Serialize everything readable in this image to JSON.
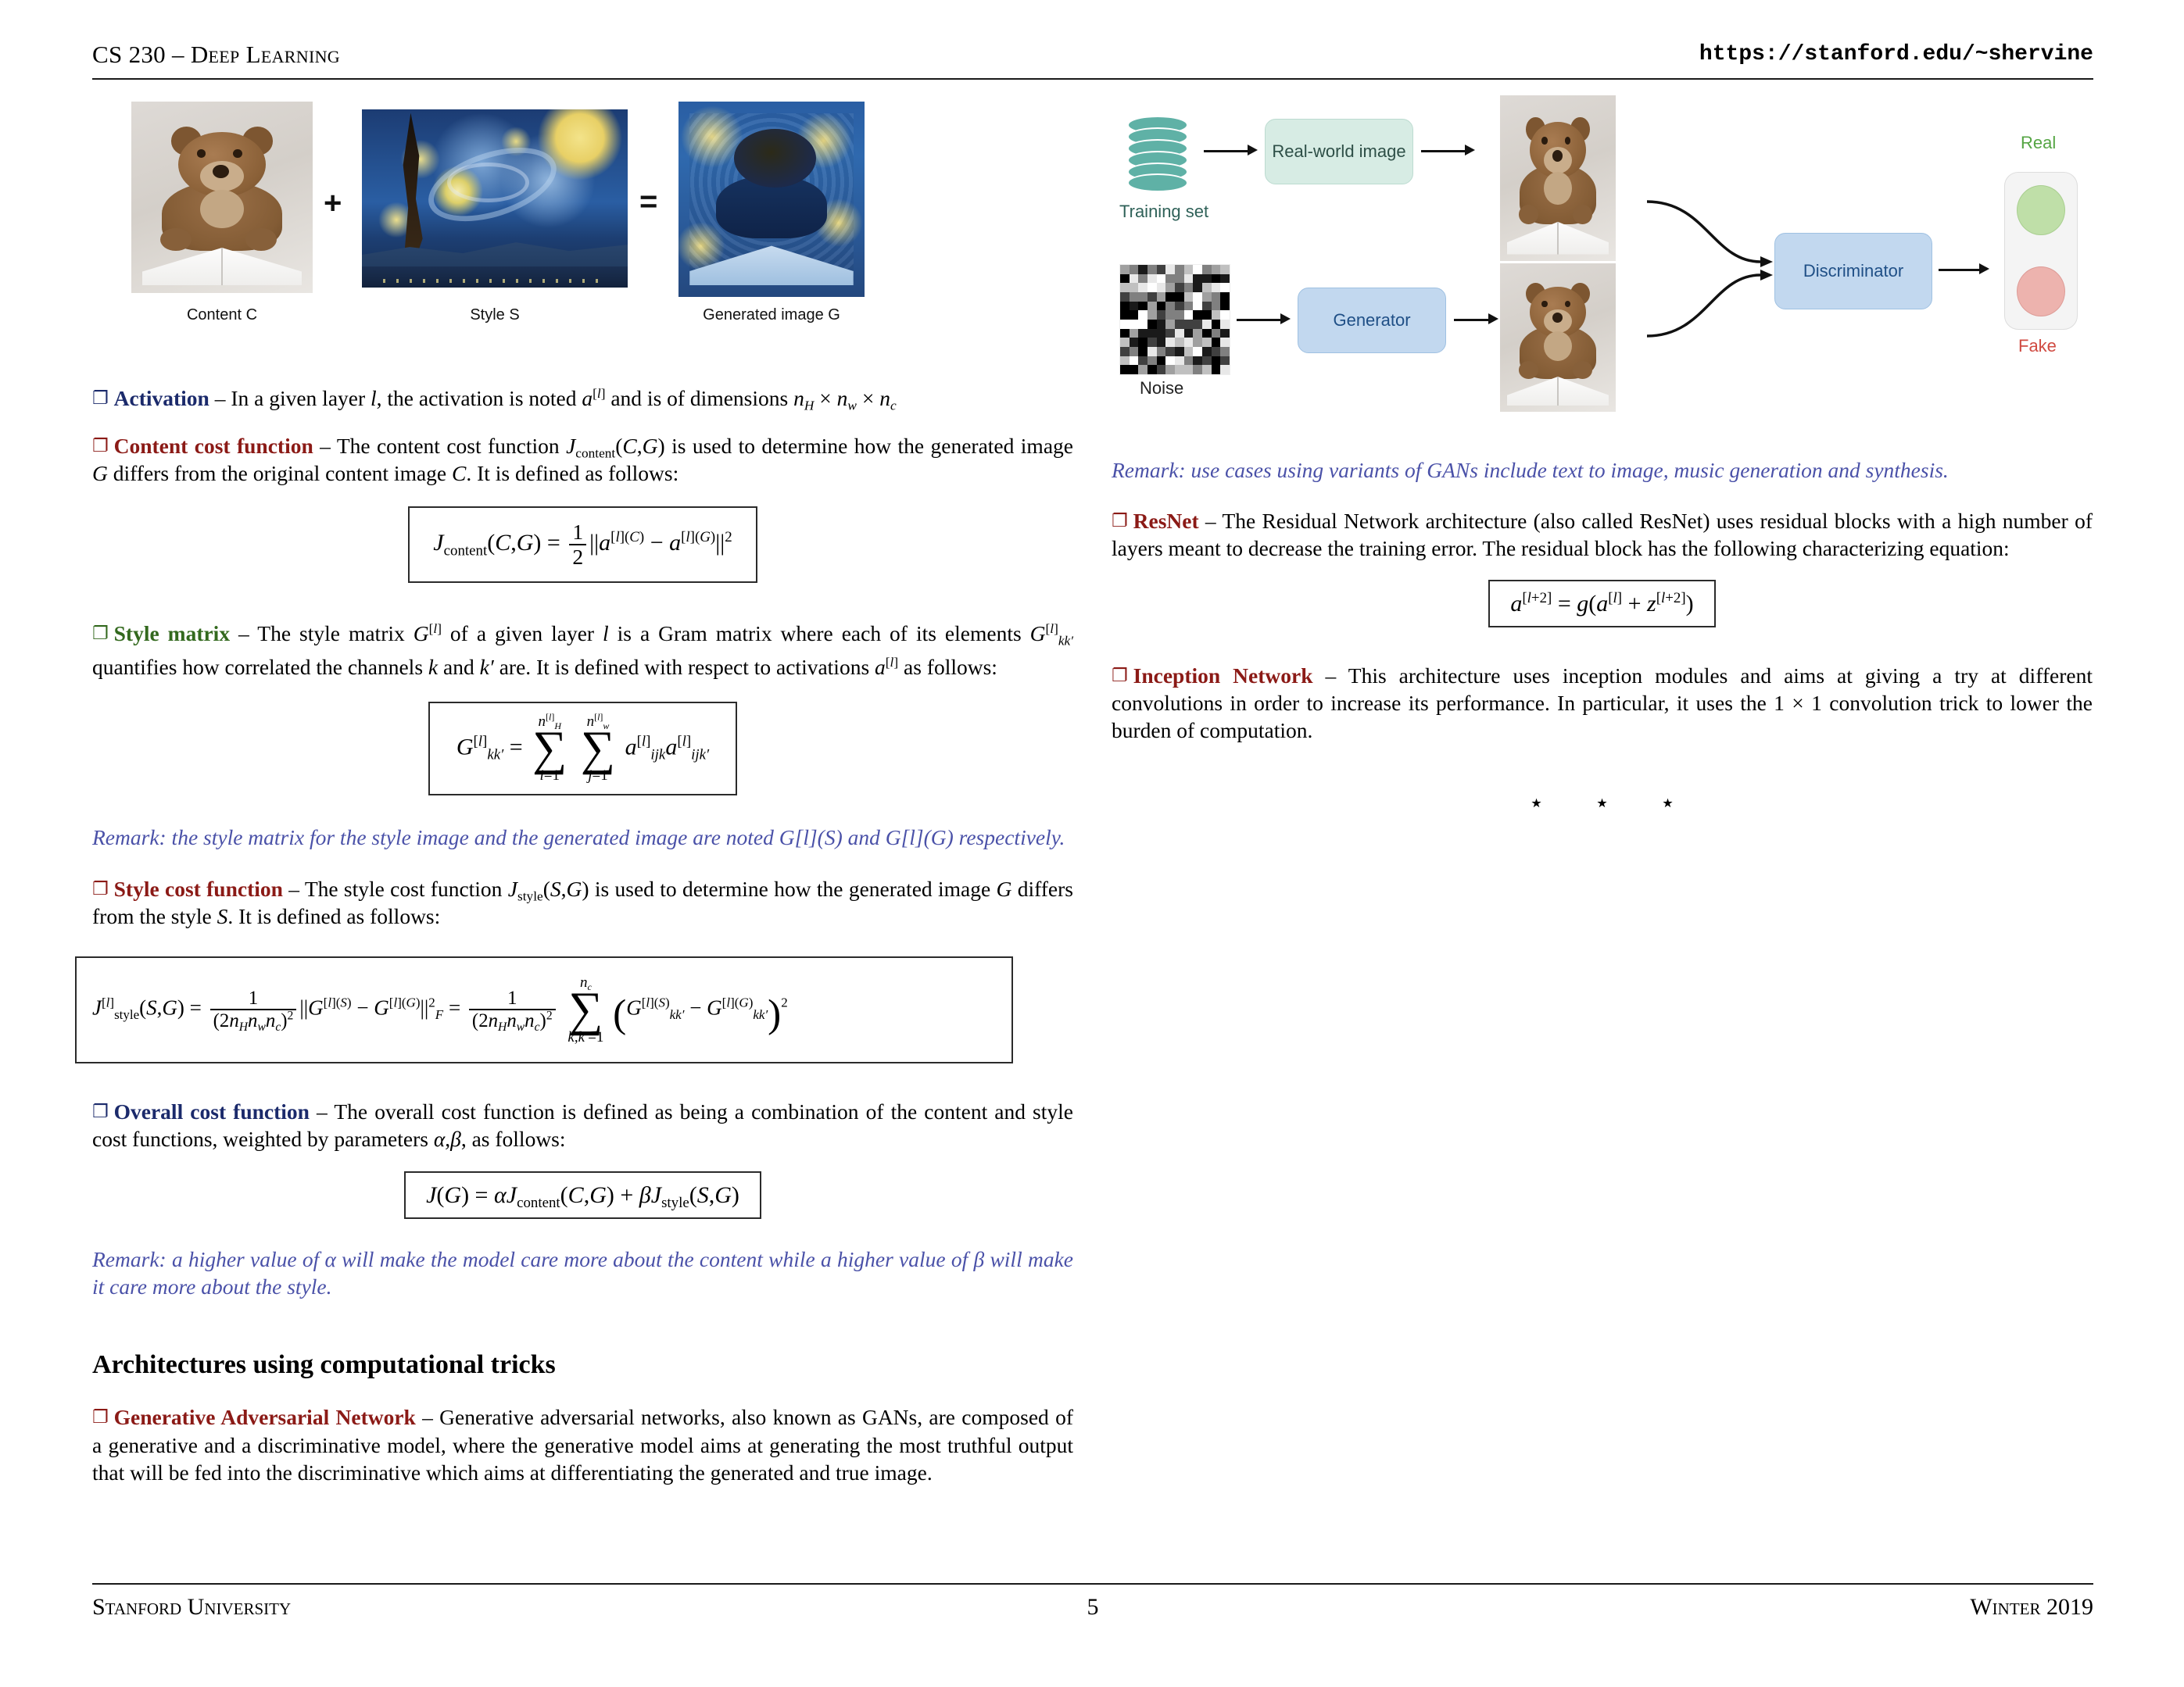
{
  "header": {
    "course": "CS 230 – Deep Learning",
    "url": "https://stanford.edu/~shervine"
  },
  "footer": {
    "left": "Stanford University",
    "page": "5",
    "right": "Winter 2019"
  },
  "style_transfer_figure": {
    "content_caption": "Content C",
    "style_caption": "Style S",
    "generated_caption": "Generated image G",
    "plus_operator": "+",
    "equals_operator": "="
  },
  "left_column": {
    "activation": {
      "bullet": "❐",
      "heading": "Activation",
      "dash": " – ",
      "text_1": "In a given layer ",
      "text_2": ", the activation is noted ",
      "text_3": " and is of dimensions ",
      "l": "l",
      "a": "a",
      "sup_l": "[l]",
      "dims": "n_H × n_w × n_c"
    },
    "content_cost": {
      "bullet": "❐",
      "heading": "Content cost function",
      "text": "– The content cost function Jcontent(C,G) is used to determine how the generated image G differs from the original content image C. It is defined as follows:",
      "equation": "J_content(C,G) = 1/2 ||a^[l](C) − a^[l](G)||^2"
    },
    "style_matrix": {
      "bullet": "❐",
      "heading": "Style matrix",
      "text": "– The style matrix G^[l] of a given layer l is a Gram matrix where each of its elements G^[l]_kk′ quantifies how correlated the channels k and k′ are. It is defined with respect to activations a^[l] as follows:",
      "equation": "G^[l]_kk′ = sum_{i=1}^{n_H^[l]} sum_{j=1}^{n_w^[l]} a^[l]_ijk a^[l]_ijk′"
    },
    "remark_style_matrix": "Remark: the style matrix for the style image and the generated image are noted G[l](S) and G[l](G) respectively.",
    "style_cost": {
      "bullet": "❐",
      "heading": "Style cost function",
      "text": "– The style cost function Jstyle(S,G) is used to determine how the generated image G differs from the style S. It is defined as follows:",
      "equation": "J^[l]_style(S,G) = 1/(2 n_H n_w n_c)^2 ||G^[l](S) − G^[l](G)||^2_F = 1/(2 n_H n_w n_c)^2 sum_{k,k′=1}^{n_c} ( G^[l](S)_kk′ − G^[l](G)_kk′ )^2"
    },
    "overall_cost": {
      "bullet": "❐",
      "heading": "Overall cost function",
      "text": "– The overall cost function is defined as being a combination of the content and style cost functions, weighted by parameters α,β, as follows:",
      "equation": "J(G) = αJcontent(C,G) + βJstyle(S,G)"
    },
    "remark_overall": "Remark: a higher value of α will make the model care more about the content while a higher value of β will make it care more about the style.",
    "section_title": "Architectures using computational tricks",
    "gan": {
      "bullet": "❐",
      "heading": "Generative Adversarial Network",
      "text": "– Generative adversarial networks, also known as GANs, are composed of a generative and a discriminative model, where the generative model aims at generating the most truthful output that will be fed into the discriminative which aims at differentiating the generated and true image."
    }
  },
  "gan_figure": {
    "training_set_label": "Training set",
    "noise_label": "Noise",
    "real_world_image_node": "Real-world image",
    "generator_node": "Generator",
    "discriminator_node": "Discriminator",
    "real_label": "Real",
    "fake_label": "Fake"
  },
  "right_column": {
    "remark_gan": "Remark: use cases using variants of GANs include text to image, music generation and synthesis.",
    "resnet": {
      "bullet": "❐",
      "heading": "ResNet",
      "text": "– The Residual Network architecture (also called ResNet) uses residual blocks with a high number of layers meant to decrease the training error. The residual block has the following characterizing equation:",
      "equation": "a^[l+2] = g(a^[l] + z^[l+2])"
    },
    "inception": {
      "bullet": "❐",
      "heading": "Inception Network",
      "text": "– This architecture uses inception modules and aims at giving a try at different convolutions in order to increase its performance. In particular, it uses the 1 × 1 convolution trick to lower the burden of computation."
    },
    "stars": "⋆ ⋆ ⋆"
  },
  "colors": {
    "navy": "#1b2a6b",
    "dark_red": "#8b1a16",
    "green": "#33691e",
    "remark_blue": "#4a51a8",
    "gan_teal": "#5fb1a6",
    "gan_blue": "#c2d8ef",
    "real_green": "#55a544",
    "fake_red": "#d04a41"
  }
}
